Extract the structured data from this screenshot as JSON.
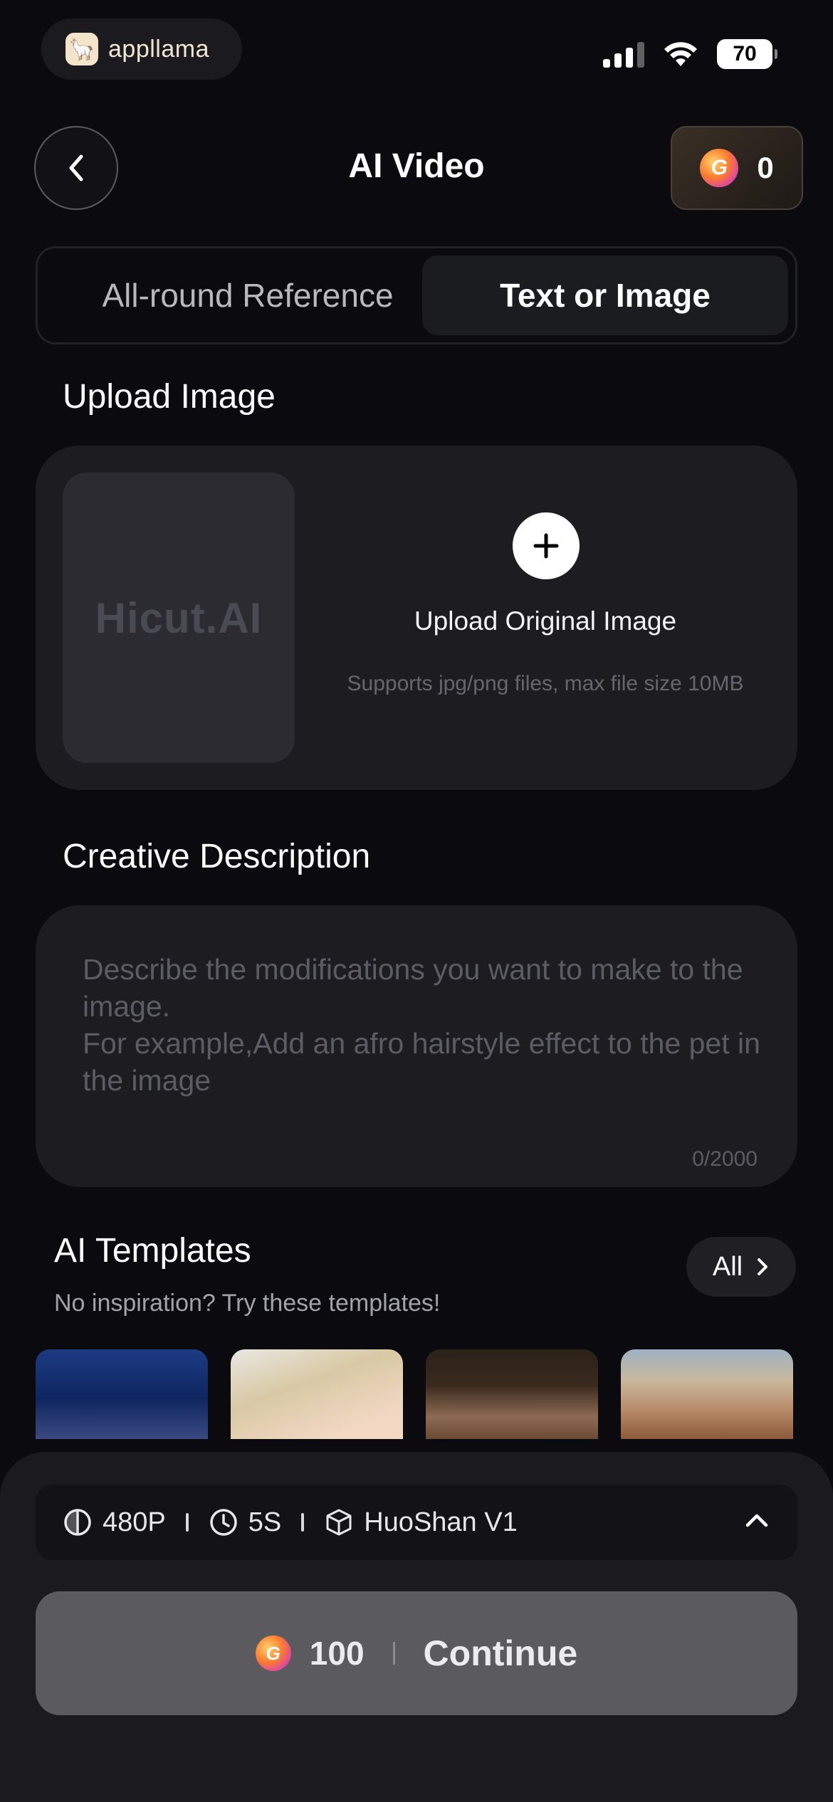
{
  "status_bar": {
    "brand": "appllama",
    "battery": "70"
  },
  "header": {
    "title": "AI Video",
    "coin_balance": "0"
  },
  "tabs": [
    {
      "label": "All-round Reference",
      "active": false
    },
    {
      "label": "Text or Image",
      "active": true
    }
  ],
  "upload": {
    "section_title": "Upload Image",
    "placeholder_brand": "Hicut.AI",
    "label": "Upload Original Image",
    "hint": "Supports jpg/png files, max file size 10MB"
  },
  "description": {
    "section_title": "Creative Description",
    "placeholder": "Describe the modifications you want to make to the image.\nFor example,Add an afro hairstyle effect to the pet in the image",
    "count": "0/2000"
  },
  "templates": {
    "title": "AI Templates",
    "subtitle": "No inspiration? Try these templates!",
    "all_label": "All"
  },
  "settings": {
    "resolution": "480P",
    "duration": "5S",
    "model": "HuoShan V1"
  },
  "action": {
    "cost": "100",
    "label": "Continue"
  },
  "colors": {
    "background": "#0b0b0f",
    "card": "#1c1c21",
    "button_disabled": "#5a5a5f"
  }
}
